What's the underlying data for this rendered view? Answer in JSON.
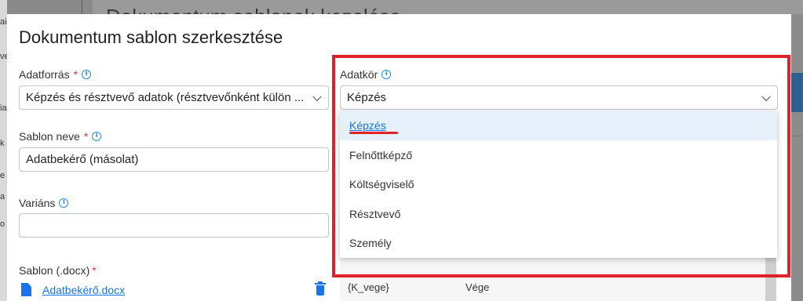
{
  "background": {
    "left_letters": [
      "ai",
      "ve",
      "ia",
      "k",
      "e",
      "a",
      "o"
    ],
    "title": "Dokumentum sablonok kezelése"
  },
  "modal": {
    "title": "Dokumentum sablon szerkesztése",
    "adatforras": {
      "label": "Adatforrás",
      "required_mark": "*",
      "value": "Képzés és résztvevő adatok (résztvevőnként külön ..."
    },
    "sablon_neve": {
      "label": "Sablon neve",
      "required_mark": "*",
      "value": "Adatbekérő (másolat)"
    },
    "varians": {
      "label": "Variáns",
      "value": ""
    },
    "sablon_docx": {
      "label": "Sablon (.docx)",
      "required_mark": "*",
      "file_name": "Adatbekérő.docx"
    },
    "adatkor": {
      "label": "Adatkör",
      "value": "Képzés",
      "options": [
        {
          "label": "Képzés",
          "selected": true
        },
        {
          "label": "Felnőttképző",
          "selected": false
        },
        {
          "label": "Költségviselő",
          "selected": false
        },
        {
          "label": "Résztvevő",
          "selected": false
        },
        {
          "label": "Személy",
          "selected": false
        }
      ]
    },
    "table_row": {
      "key": "{K_vege}",
      "name": "Vége"
    }
  },
  "icons": {
    "info": "info-icon",
    "chevron": "chevron-down-icon",
    "file": "file-icon",
    "trash": "trash-icon"
  },
  "colors": {
    "accent": "#1a73e8",
    "highlight": "#e0202a",
    "required": "#dc3545",
    "selected_bg": "#e6f0fa"
  }
}
